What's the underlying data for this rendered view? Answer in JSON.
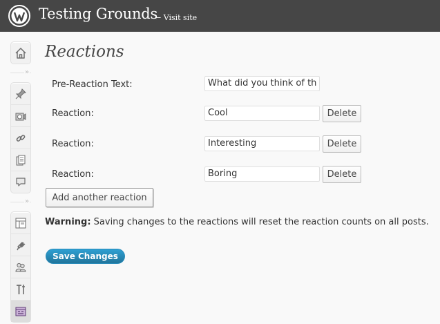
{
  "header": {
    "site_title": "Testing Grounds",
    "visit_site": "← Visit site",
    "background": "#464646"
  },
  "admin_menu": {
    "icons": [
      "dashboard-icon",
      "posts-icon",
      "media-icon",
      "links-icon",
      "pages-icon",
      "comments-icon",
      "appearance-icon",
      "plugins-icon",
      "users-icon",
      "tools-icon",
      "settings-icon"
    ],
    "current": "settings-icon",
    "separator_arrow": "»"
  },
  "page": {
    "title": "Reactions",
    "pre_reaction_label": "Pre-Reaction Text:",
    "pre_reaction_value": "What did you think of th",
    "reactions": [
      {
        "label": "Reaction:",
        "value": "Cool",
        "delete_label": "Delete"
      },
      {
        "label": "Reaction:",
        "value": "Interesting",
        "delete_label": "Delete"
      },
      {
        "label": "Reaction:",
        "value": "Boring",
        "delete_label": "Delete"
      }
    ],
    "add_reaction_label": "Add another reaction",
    "warning_strong": "Warning:",
    "warning_text": " Saving changes to the reactions will reset the reaction counts on all posts.",
    "save_label": "Save Changes",
    "primary_color": "#21759b"
  }
}
